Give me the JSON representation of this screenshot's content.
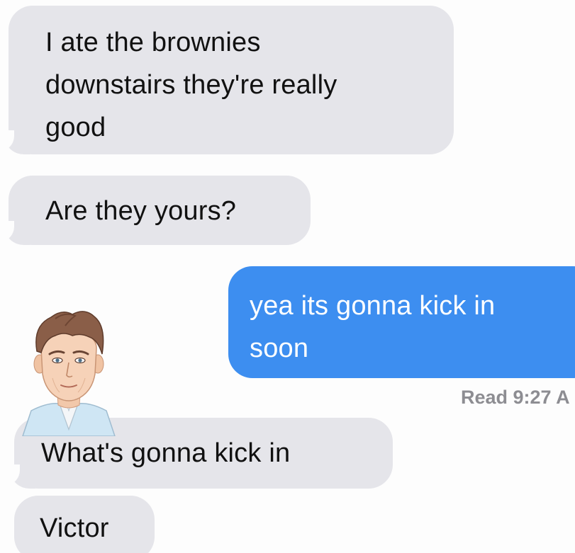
{
  "conversation": {
    "messages": [
      {
        "direction": "incoming",
        "text": "I ate the brownies\ndownstairs they're really\ngood"
      },
      {
        "direction": "incoming",
        "text": "Are they yours?"
      },
      {
        "direction": "outgoing",
        "text": "yea its gonna kick in\nsoon"
      },
      {
        "direction": "incoming",
        "text": "What's gonna kick in"
      },
      {
        "direction": "incoming",
        "text": "Victor"
      }
    ],
    "read_receipt": "Read 9:27 A"
  },
  "colors": {
    "incoming_bubble": "#e5e5ea",
    "outgoing_bubble": "#3d8ef0",
    "receipt_text": "#8d8d92"
  },
  "icons": {
    "avatar": "cartoon-man-avatar-icon"
  }
}
